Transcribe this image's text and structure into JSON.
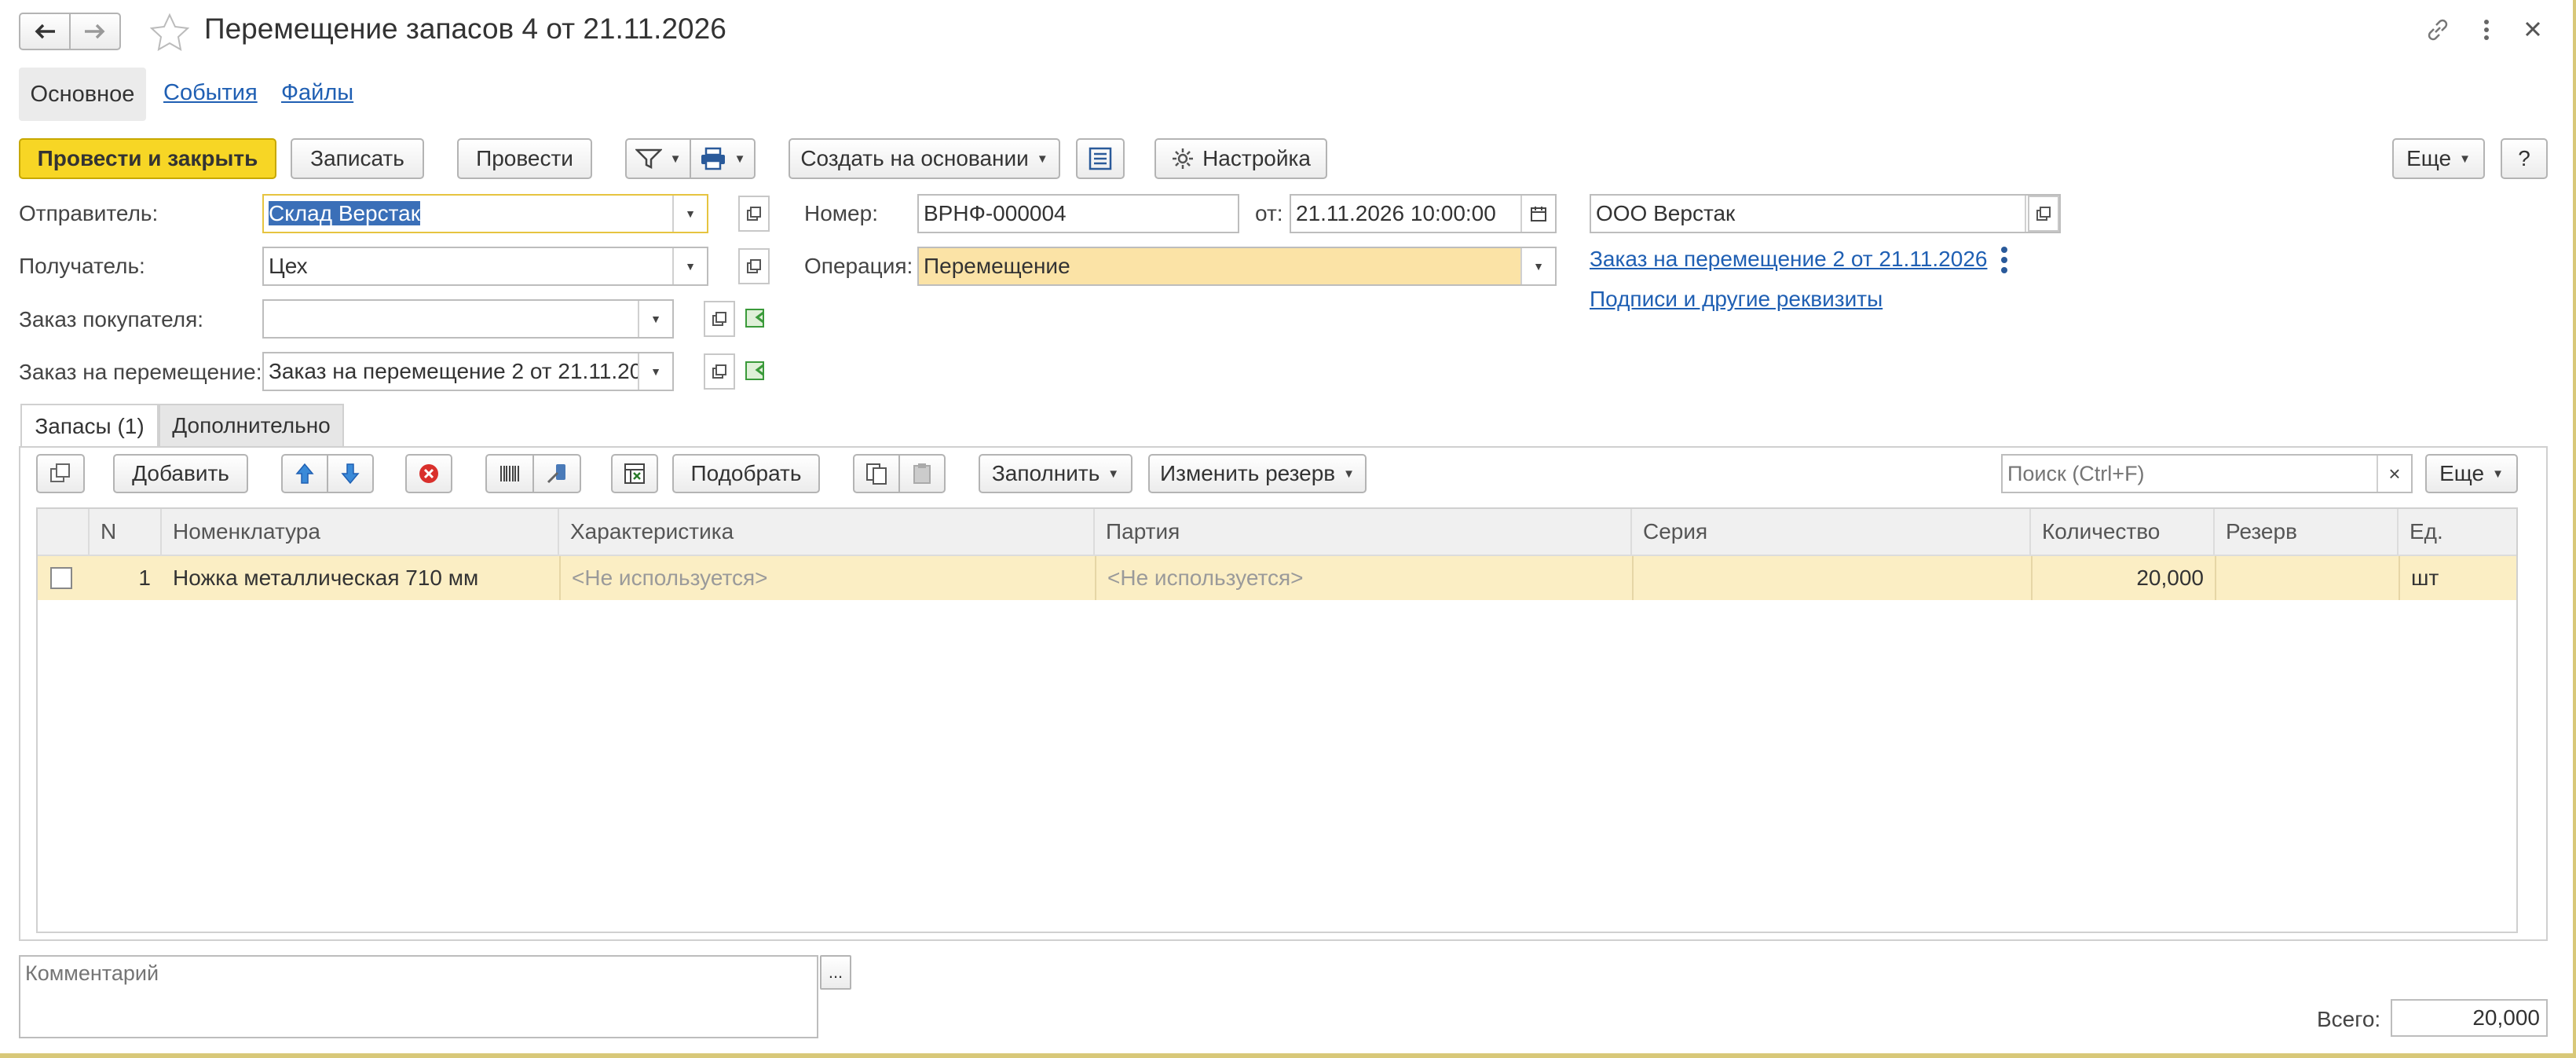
{
  "window": {
    "title": "Перемещение запасов 4 от 21.11.2026"
  },
  "nav_tabs": [
    {
      "label": "Основное"
    },
    {
      "label": "События"
    },
    {
      "label": "Файлы"
    }
  ],
  "toolbar": {
    "post_close": "Провести и закрыть",
    "save": "Записать",
    "post": "Провести",
    "create_based": "Создать на основании",
    "settings": "Настройка",
    "more": "Еще",
    "help": "?"
  },
  "form": {
    "sender_label": "Отправитель:",
    "sender_value": "Склад Верстак",
    "receiver_label": "Получатель:",
    "receiver_value": "Цех",
    "customer_order_label": "Заказ покупателя:",
    "customer_order_value": "",
    "transfer_order_label": "Заказ на перемещение:",
    "transfer_order_value": "Заказ на перемещение 2 от 21.11.2026",
    "number_label": "Номер:",
    "number_value": "ВРНФ-000004",
    "date_label": "от:",
    "date_value": "21.11.2026 10:00:00",
    "operation_label": "Операция:",
    "operation_value": "Перемещение",
    "organization_value": "ООО Верстак",
    "transfer_order_link": "Заказ на перемещение 2 от 21.11.2026",
    "signatures_link": "Подписи и другие реквизиты"
  },
  "content_tabs": [
    {
      "label": "Запасы (1)"
    },
    {
      "label": "Дополнительно"
    }
  ],
  "table_toolbar": {
    "add": "Добавить",
    "pick": "Подобрать",
    "fill": "Заполнить",
    "change_reserve": "Изменить резерв",
    "search_placeholder": "Поиск (Ctrl+F)",
    "search_clear": "×",
    "more": "Еще"
  },
  "table": {
    "columns": [
      "N",
      "Номенклатура",
      "Характеристика",
      "Партия",
      "Серия",
      "Количество",
      "Резерв",
      "Ед."
    ],
    "rows": [
      {
        "n": "1",
        "item": "Ножка металлическая 710 мм",
        "characteristic": "<Не используется>",
        "batch": "<Не используется>",
        "series": "",
        "quantity": "20,000",
        "reserve": "",
        "unit": "шт"
      }
    ]
  },
  "footer": {
    "comment_placeholder": "Комментарий",
    "comment_button": "...",
    "total_label": "Всего:",
    "total_value": "20,000"
  },
  "colors": {
    "primary_button": "#f7d625",
    "operation_field": "#fbe3a6",
    "row_highlight": "#fbeec4",
    "link": "#1f5fb3"
  }
}
